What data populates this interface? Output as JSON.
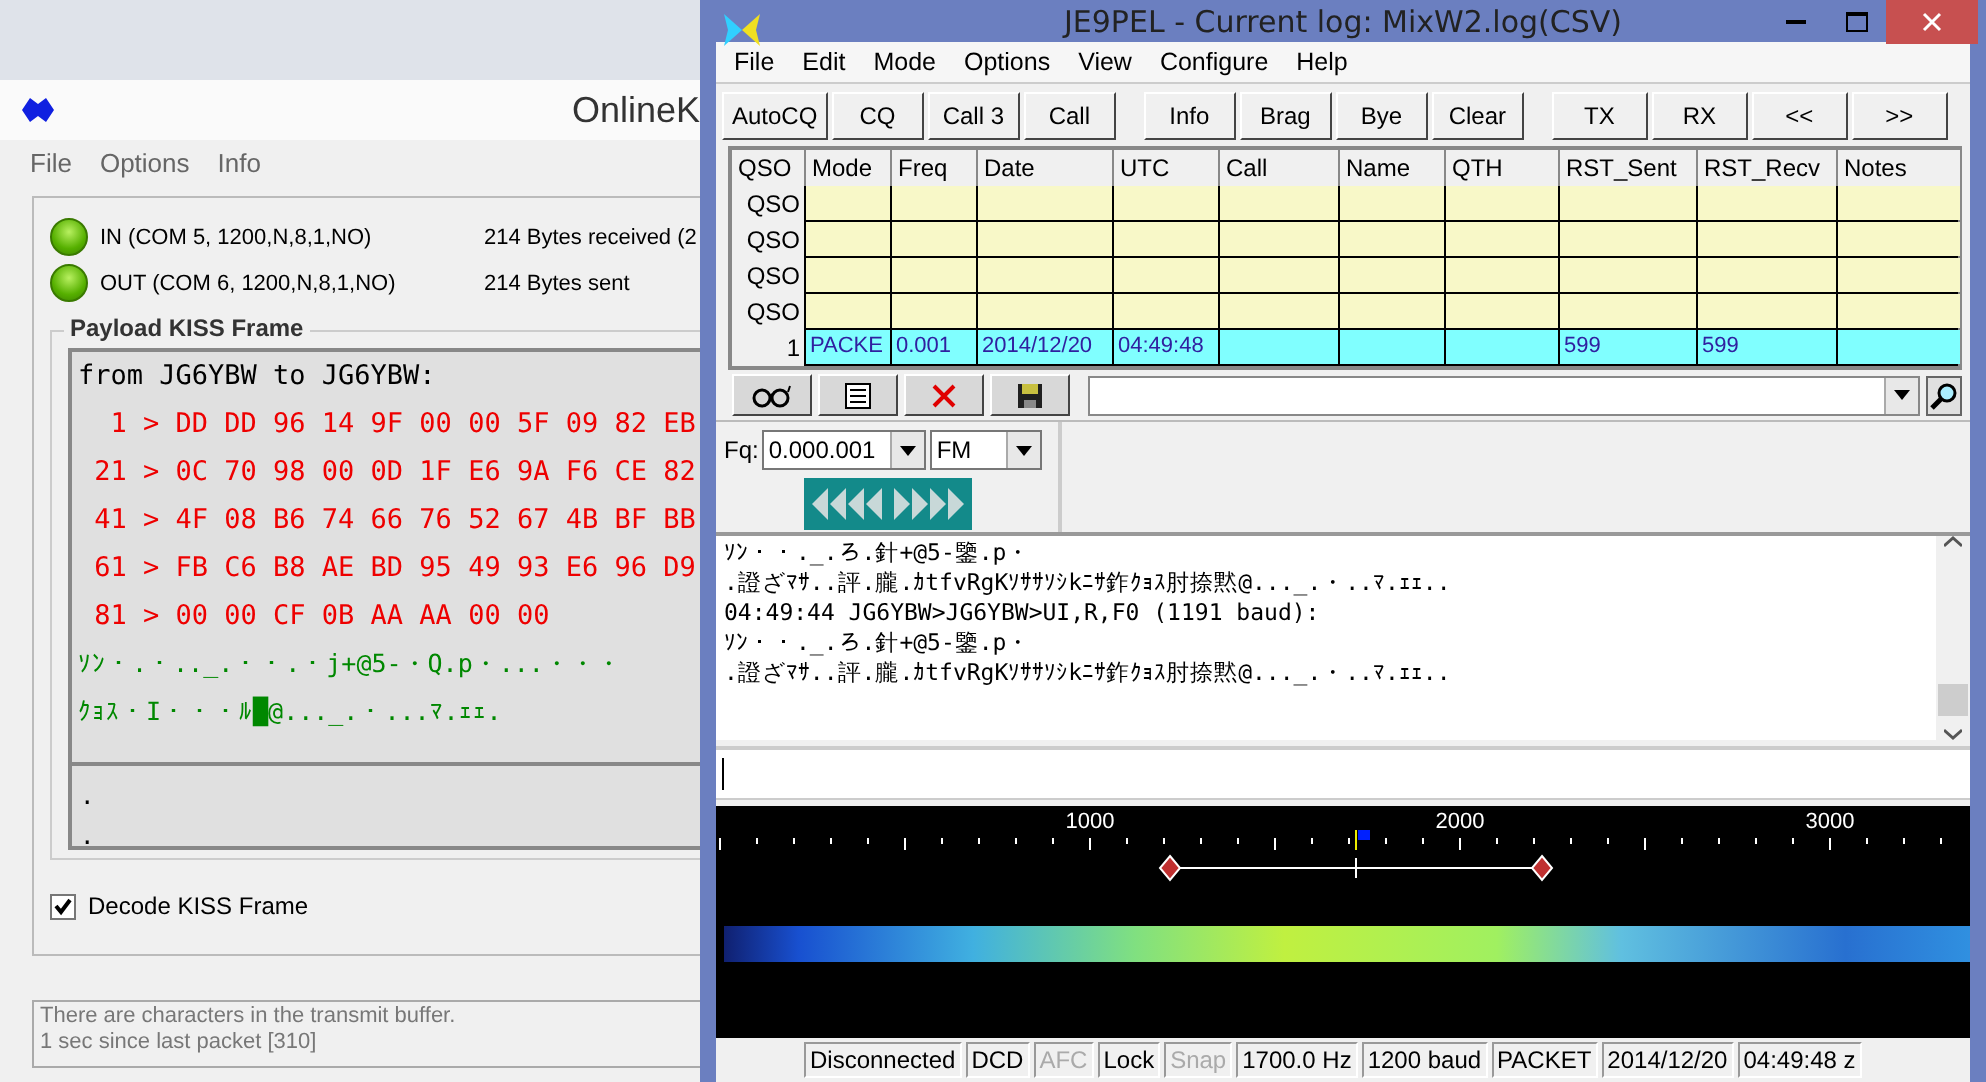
{
  "left_window": {
    "title": "OnlineK",
    "menu": [
      "File",
      "Options",
      "Info"
    ],
    "ports": [
      {
        "label": "IN (COM 5, 1200,N,8,1,NO)",
        "stat": "214 Bytes received (2",
        "on": true
      },
      {
        "label": "OUT (COM 6, 1200,N,8,1,NO)",
        "stat": "214 Bytes sent",
        "on": true
      }
    ],
    "frame": {
      "title": "Payload KISS Frame",
      "lines": [
        {
          "kind": "header",
          "text": "from JG6YBW to JG6YBW:"
        },
        {
          "kind": "hex",
          "text": "  1 > DD DD 96 14 9F 00 00 5F 09 82 EB"
        },
        {
          "kind": "hex",
          "text": " 21 > 0C 70 98 00 0D 1F E6 9A F6 CE 82"
        },
        {
          "kind": "hex",
          "text": " 41 > 4F 08 B6 74 66 76 52 67 4B BF BB"
        },
        {
          "kind": "hex",
          "text": " 61 > FB C6 B8 AE BD 95 49 93 E6 96 D9"
        },
        {
          "kind": "hex",
          "text": " 81 > 00 00 CF 0B AA AA 00 00"
        },
        {
          "kind": "text",
          "text": "ｿﾝ・.・.._.・・.・j+@5-・Q.p・...・・・"
        },
        {
          "kind": "text",
          "text": "ｸｮｽ・I・・・ﾙ█@..._.・...ﾏ.ｪｪ."
        }
      ],
      "dots": [
        ".",
        "."
      ]
    },
    "decode_checkbox": {
      "label": "Decode KISS Frame",
      "checked": true
    },
    "messages": [
      "There are characters in the transmit buffer.",
      "1 sec since last packet [310]"
    ]
  },
  "main_window": {
    "title": "JE9PEL - Current log: MixW2.log(CSV)",
    "menu": [
      "File",
      "Edit",
      "Mode",
      "Options",
      "View",
      "Configure",
      "Help"
    ],
    "button_groups": [
      [
        "AutoCQ",
        "CQ",
        "Call 3",
        "Call"
      ],
      [
        "Info",
        "Brag",
        "Bye",
        "Clear"
      ],
      [
        "TX",
        "RX",
        "<<",
        ">>"
      ]
    ],
    "table": {
      "columns": [
        "QSO",
        "Mode",
        "Freq",
        "Date",
        "UTC",
        "Call",
        "Name",
        "QTH",
        "RST_Sent",
        "RST_Recv",
        "Notes"
      ],
      "rows": [
        {
          "cells": [
            "QSO",
            "",
            "",
            "",
            "",
            "",
            "",
            "",
            "",
            "",
            ""
          ],
          "selected": false
        },
        {
          "cells": [
            "QSO",
            "",
            "",
            "",
            "",
            "",
            "",
            "",
            "",
            "",
            ""
          ],
          "selected": false
        },
        {
          "cells": [
            "QSO",
            "",
            "",
            "",
            "",
            "",
            "",
            "",
            "",
            "",
            ""
          ],
          "selected": false
        },
        {
          "cells": [
            "QSO",
            "",
            "",
            "",
            "",
            "",
            "",
            "",
            "",
            "",
            ""
          ],
          "selected": false
        },
        {
          "cells": [
            "1",
            "PACKE",
            "0.001",
            "2014/12/20",
            "04:49:48",
            "",
            "",
            "",
            "599",
            "599",
            ""
          ],
          "selected": true
        }
      ]
    },
    "eq": {
      "label": "Fq:",
      "freq": "0.000.001",
      "mode": "FM"
    },
    "receive_lines": [
      "ｿﾝ・・._.ろ.針+@5-鑒.p・",
      ".證ざﾏｻ..評.朧.ｶtfvRgKｿｻｻｿｼkﾆｻ鈼ｸｮｽ肘捺黙@..._.・..ﾏ.ｪｪ..",
      "04:49:44 JG6YBW>JG6YBW>UI,R,F0 (1191 baud):",
      "ｿﾝ・・._.ろ.針+@5-鑒.p・",
      ".證ざﾏｻ..評.朧.ｶtfvRgKｿｻｻｿｼkﾆｻ鈼ｸｮｽ肘捺黙@..._.・..ﾏ.ｪｪ.."
    ],
    "waterfall": {
      "scale": [
        "1000",
        "2000",
        "3000"
      ]
    },
    "status_bar": [
      {
        "text": "Disconnected",
        "disabled": false
      },
      {
        "text": "DCD",
        "disabled": false
      },
      {
        "text": "AFC",
        "disabled": true
      },
      {
        "text": "Lock",
        "disabled": false
      },
      {
        "text": "Snap",
        "disabled": true
      },
      {
        "text": "1700.0 Hz",
        "disabled": false
      },
      {
        "text": "1200 baud",
        "disabled": false
      },
      {
        "text": "PACKET",
        "disabled": false
      },
      {
        "text": "2014/12/20",
        "disabled": false
      },
      {
        "text": "04:49:48 z",
        "disabled": false
      }
    ]
  }
}
